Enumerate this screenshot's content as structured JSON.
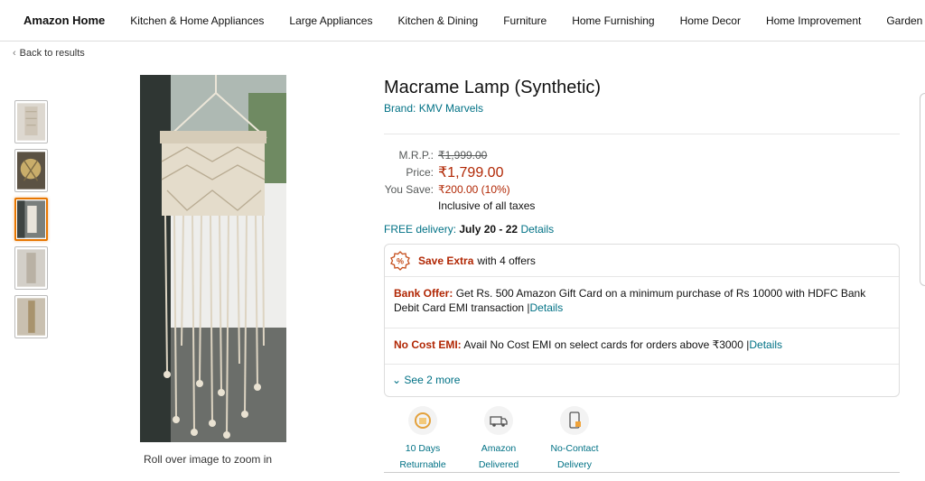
{
  "nav": {
    "brand": "Amazon Home",
    "items": [
      "Kitchen & Home Appliances",
      "Large Appliances",
      "Kitchen & Dining",
      "Furniture",
      "Home Furnishing",
      "Home Decor",
      "Home Improvement",
      "Garden & Outdoor"
    ]
  },
  "back_link": "Back to results",
  "zoom_note": "Roll over image to zoom in",
  "product": {
    "title": "Macrame Lamp (Synthetic)",
    "brand": "Brand: KMV Marvels"
  },
  "pricing": {
    "mrp_label": "M.R.P.:",
    "mrp": "₹1,999.00",
    "price_label": "Price:",
    "price": "₹1,799.00",
    "save_label": "You Save:",
    "save": "₹200.00 (10%)",
    "taxes": "Inclusive of all taxes"
  },
  "delivery": {
    "label": "FREE delivery:",
    "dates": "July 20 - 22",
    "details": "Details"
  },
  "offers": {
    "save_extra": "Save Extra",
    "with_offers": "with 4 offers",
    "bank_label": "Bank Offer:",
    "bank_text": "Get Rs. 500 Amazon Gift Card on a minimum purchase of Rs 10000 with HDFC Bank Debit Card EMI transaction |",
    "bank_details": "Details",
    "emi_label": "No Cost EMI:",
    "emi_text": "Avail No Cost EMI on select cards for orders above ₹3000 |",
    "emi_details": "Details",
    "see_more": "See 2 more"
  },
  "badges": [
    {
      "line1": "10 Days",
      "line2": "Returnable",
      "icon": "returnable-icon"
    },
    {
      "line1": "Amazon",
      "line2": "Delivered",
      "icon": "delivery-truck-icon"
    },
    {
      "line1": "No-Contact",
      "line2": "Delivery",
      "icon": "no-contact-icon"
    }
  ],
  "colors": {
    "link": "#007185",
    "price_red": "#b12704",
    "selected_thumb": "#e77600"
  }
}
